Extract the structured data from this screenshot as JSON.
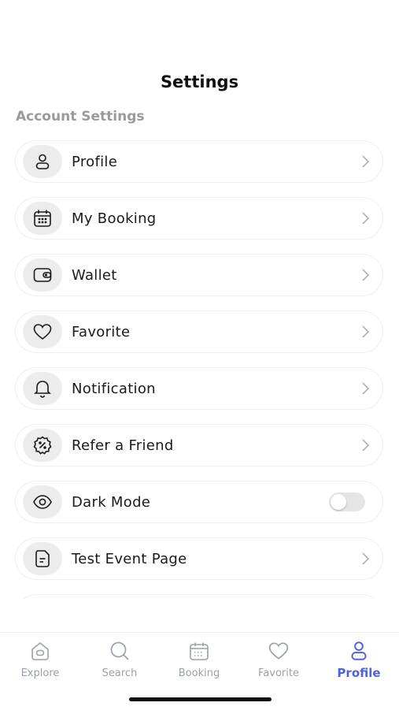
{
  "header": {
    "title": "Settings"
  },
  "section": {
    "label": "Account Settings"
  },
  "settings": {
    "items": [
      {
        "label": "Profile",
        "icon": "user-icon"
      },
      {
        "label": "My Booking",
        "icon": "calendar-icon"
      },
      {
        "label": "Wallet",
        "icon": "wallet-icon"
      },
      {
        "label": "Favorite",
        "icon": "heart-icon"
      },
      {
        "label": "Notification",
        "icon": "bell-icon"
      },
      {
        "label": "Refer a Friend",
        "icon": "badge-percent-icon"
      },
      {
        "label": "Dark Mode",
        "icon": "eye-icon",
        "toggle": false
      },
      {
        "label": "Test Event Page",
        "icon": "document-icon"
      }
    ]
  },
  "tabbar": {
    "tabs": [
      {
        "label": "Explore",
        "icon": "home-icon"
      },
      {
        "label": "Search",
        "icon": "search-icon"
      },
      {
        "label": "Booking",
        "icon": "calendar-icon"
      },
      {
        "label": "Favorite",
        "icon": "heart-icon"
      },
      {
        "label": "Profile",
        "icon": "user-icon",
        "active": true
      }
    ]
  },
  "colors": {
    "accent": "#4f62d8",
    "inactive_tab": "#9aa0ad",
    "icon_bg": "#ececec",
    "section_label": "#9a9a9a"
  }
}
